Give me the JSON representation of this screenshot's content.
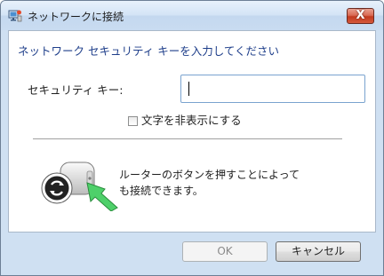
{
  "window": {
    "title": "ネットワークに接続",
    "close_label": "X"
  },
  "content": {
    "instruction": "ネットワーク セキュリティ キーを入力してください",
    "security_key_label": "セキュリティ キー:",
    "security_key_value": "",
    "hide_chars_label": "文字を非表示にする",
    "hide_chars_checked": false,
    "router_text_line1": "ルーターのボタンを押すことによって",
    "router_text_line2": "も接続できます。"
  },
  "buttons": {
    "ok_label": "OK",
    "cancel_label": "キャンセル"
  }
}
